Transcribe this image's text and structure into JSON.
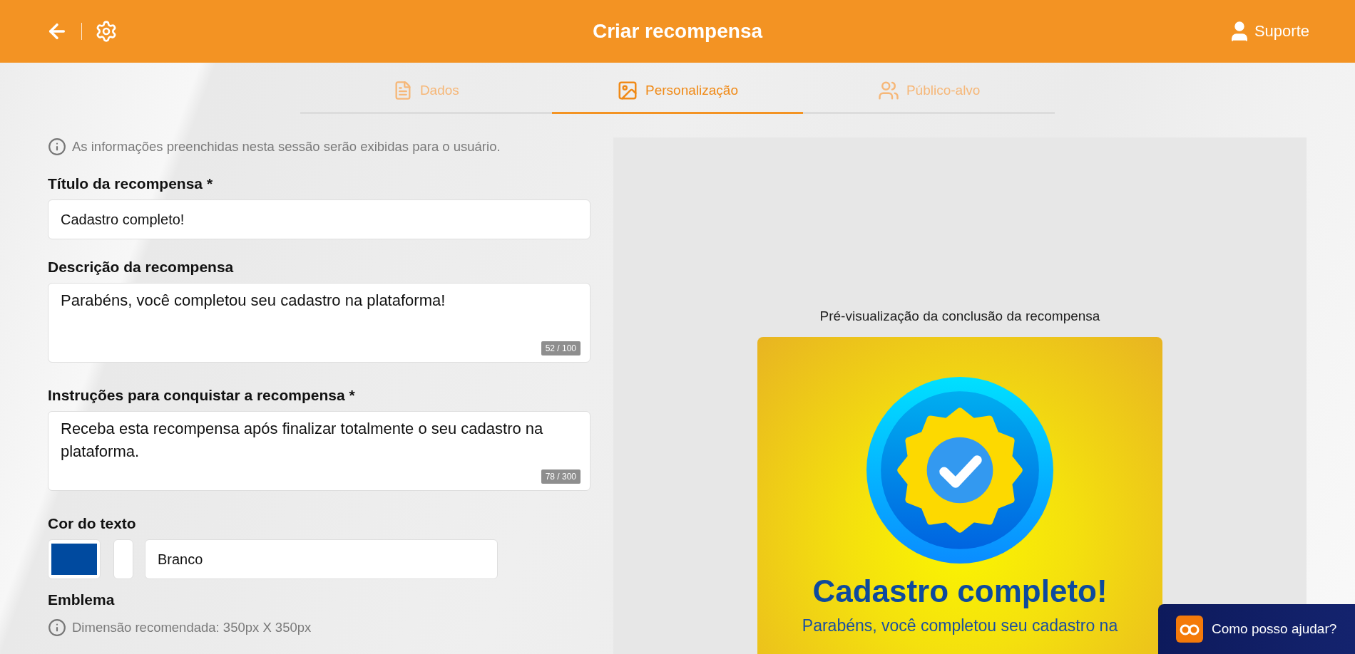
{
  "header": {
    "title": "Criar recompensa",
    "support_label": "Suporte"
  },
  "tabs": [
    {
      "label": "Dados",
      "kind": "document",
      "selected": false
    },
    {
      "label": "Personalização",
      "kind": "image",
      "selected": true
    },
    {
      "label": "Público-alvo",
      "kind": "audience",
      "selected": false
    }
  ],
  "form": {
    "notice": "As informações preenchidas nesta sessão serão exibidas para o usuário.",
    "fields": [
      {
        "kind": "input",
        "label": "Título da recompensa *",
        "value": "Cadastro completo!"
      },
      {
        "kind": "textarea",
        "label": "Descrição da recompensa",
        "value": "Parabéns, você completou seu cadastro na plataforma!",
        "counter": "52 / 100"
      },
      {
        "kind": "textarea",
        "label": "Instruções para conquistar a recompensa *",
        "value": "Receba esta recompensa após finalizar totalmente o seu cadastro na plataforma.",
        "counter": "78 / 300"
      }
    ],
    "text_color": {
      "label": "Cor do texto",
      "color": "#004a9f",
      "value": "Branco"
    },
    "emblem": {
      "label": "Emblema",
      "hint": "Dimensão recomendada: 350px X 350px"
    }
  },
  "preview": {
    "caption": "Pré-visualização da conclusão da recompensa",
    "title": "Cadastro completo!",
    "description": "Parabéns, você completou seu cadastro na"
  },
  "chat": {
    "label": "Como posso ajudar?"
  }
}
